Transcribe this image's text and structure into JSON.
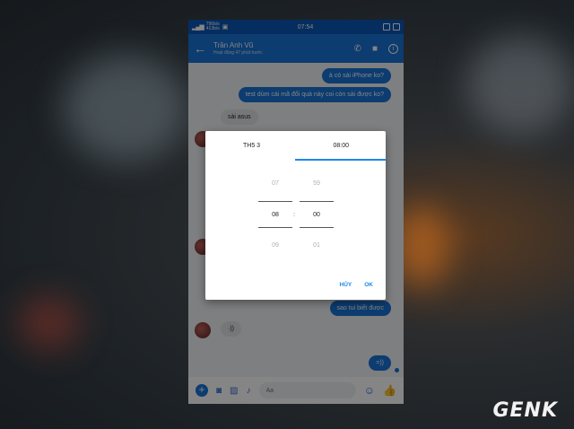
{
  "status_bar": {
    "net_up": "796b/s",
    "net_down": "413b/s",
    "time": "07:54"
  },
  "header": {
    "back_icon": "arrow-left-icon",
    "contact_name": "Trần Anh Vũ",
    "contact_status": "Hoạt động 47 phút trước"
  },
  "messages": [
    {
      "dir": "out",
      "text": "à có sài iPhone ko?"
    },
    {
      "dir": "out",
      "text": "test dùm cái mã đổi quà này coi còn sài được ko?"
    },
    {
      "dir": "in",
      "text": "sài asus"
    },
    {
      "dir": "out",
      "text": "sao tui biết được"
    },
    {
      "dir": "in",
      "text": "·))"
    },
    {
      "dir": "out",
      "text": "=))"
    }
  ],
  "composer": {
    "placeholder": "Aa"
  },
  "dialog": {
    "tab_date": "TH5 3",
    "tab_time": "08:00",
    "hours": {
      "prev": "07",
      "selected": "08",
      "next": "09"
    },
    "minutes": {
      "prev": "59",
      "selected": "00",
      "next": "01"
    },
    "separator": ":",
    "cancel_label": "HỦY",
    "ok_label": "OK"
  },
  "watermark": "GENK",
  "colors": {
    "messenger_blue": "#1773d6",
    "dialog_accent": "#1e88e5"
  }
}
